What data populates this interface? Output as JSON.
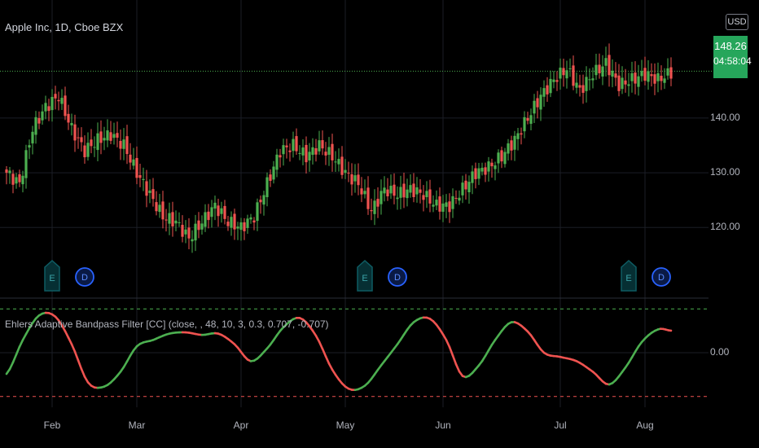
{
  "header": {
    "title": "Apple Inc, 1D, Cboe BZX",
    "currency": "USD",
    "last_price": "148.26",
    "countdown": "04:58:04"
  },
  "indicator": {
    "title": "Ehlers Adaptive Bandpass Filter [CC] (close, , 48, 10, 3, 0.3, 0.707, -0.707)"
  },
  "events": [
    {
      "type": "E",
      "label": "E"
    },
    {
      "type": "D",
      "label": "D"
    },
    {
      "type": "E",
      "label": "E"
    },
    {
      "type": "D",
      "label": "D"
    },
    {
      "type": "E",
      "label": "E"
    },
    {
      "type": "D",
      "label": "D"
    }
  ],
  "colors": {
    "up": "#4caf50",
    "down": "#ef5350",
    "earnings": "#0e5c63",
    "dividend": "#2962ff",
    "upper_band": "#4caf50",
    "lower_band": "#ef5350"
  },
  "chart_data": [
    {
      "type": "candlestick",
      "title": "Apple Inc, 1D, Cboe BZX",
      "x_ticks": [
        "Feb",
        "Mar",
        "Apr",
        "May",
        "Jun",
        "Jul",
        "Aug"
      ],
      "y_ticks": [
        {
          "label": "140.00",
          "value": 140
        },
        {
          "label": "130.00",
          "value": 130
        },
        {
          "label": "120.00",
          "value": 120
        }
      ],
      "ylim": [
        113,
        155
      ],
      "last_price": 148.26,
      "price_path": [
        [
          0,
          130
        ],
        [
          4,
          128
        ],
        [
          8,
          138
        ],
        [
          12,
          142
        ],
        [
          16,
          144
        ],
        [
          20,
          138
        ],
        [
          24,
          134
        ],
        [
          28,
          136
        ],
        [
          32,
          137
        ],
        [
          36,
          135
        ],
        [
          40,
          130
        ],
        [
          44,
          126
        ],
        [
          48,
          122
        ],
        [
          52,
          121
        ],
        [
          56,
          118
        ],
        [
          60,
          121
        ],
        [
          64,
          124
        ],
        [
          68,
          121
        ],
        [
          72,
          120
        ],
        [
          76,
          122
        ],
        [
          80,
          128
        ],
        [
          84,
          134
        ],
        [
          88,
          135
        ],
        [
          92,
          133
        ],
        [
          96,
          135
        ],
        [
          100,
          133
        ],
        [
          104,
          130
        ],
        [
          108,
          128
        ],
        [
          112,
          123
        ],
        [
          116,
          127
        ],
        [
          120,
          126
        ],
        [
          124,
          127
        ],
        [
          128,
          126
        ],
        [
          132,
          124
        ],
        [
          136,
          124
        ],
        [
          140,
          127
        ],
        [
          144,
          130
        ],
        [
          148,
          131
        ],
        [
          152,
          133
        ],
        [
          156,
          136
        ],
        [
          160,
          140
        ],
        [
          164,
          144
        ],
        [
          168,
          147
        ],
        [
          172,
          149
        ],
        [
          176,
          145
        ],
        [
          180,
          148
        ],
        [
          184,
          150
        ],
        [
          188,
          146
        ],
        [
          192,
          147
        ],
        [
          196,
          148
        ],
        [
          200,
          147
        ],
        [
          204,
          148.26
        ]
      ],
      "earnings_days": [
        14,
        110,
        191
      ],
      "dividend_days": [
        24,
        120,
        201
      ]
    },
    {
      "type": "line",
      "title": "Ehlers Adaptive Bandpass Filter [CC] (close, , 48, 10, 3, 0.3, 0.707, -0.707)",
      "y_ticks": [
        {
          "label": "0.00",
          "value": 0
        }
      ],
      "ylim": [
        -1.2,
        1.05
      ],
      "upper_band": 0.707,
      "lower_band": -0.707,
      "points": [
        [
          0,
          -0.5
        ],
        [
          5,
          0.3
        ],
        [
          10,
          0.88
        ],
        [
          15,
          0.85
        ],
        [
          20,
          0.2
        ],
        [
          25,
          -0.7
        ],
        [
          30,
          -0.8
        ],
        [
          35,
          -0.45
        ],
        [
          40,
          0.15
        ],
        [
          45,
          0.3
        ],
        [
          50,
          0.45
        ],
        [
          55,
          0.48
        ],
        [
          60,
          0.42
        ],
        [
          65,
          0.45
        ],
        [
          70,
          0.2
        ],
        [
          75,
          -0.2
        ],
        [
          80,
          0.1
        ],
        [
          85,
          0.6
        ],
        [
          90,
          0.82
        ],
        [
          95,
          0.4
        ],
        [
          100,
          -0.4
        ],
        [
          105,
          -0.85
        ],
        [
          110,
          -0.78
        ],
        [
          115,
          -0.3
        ],
        [
          120,
          0.2
        ],
        [
          125,
          0.72
        ],
        [
          130,
          0.8
        ],
        [
          135,
          0.3
        ],
        [
          140,
          -0.55
        ],
        [
          145,
          -0.3
        ],
        [
          150,
          0.3
        ],
        [
          155,
          0.72
        ],
        [
          160,
          0.5
        ],
        [
          165,
          0.0
        ],
        [
          170,
          -0.1
        ],
        [
          175,
          -0.2
        ],
        [
          180,
          -0.45
        ],
        [
          185,
          -0.75
        ],
        [
          190,
          -0.35
        ],
        [
          195,
          0.25
        ],
        [
          200,
          0.55
        ],
        [
          204,
          0.52
        ]
      ]
    }
  ]
}
